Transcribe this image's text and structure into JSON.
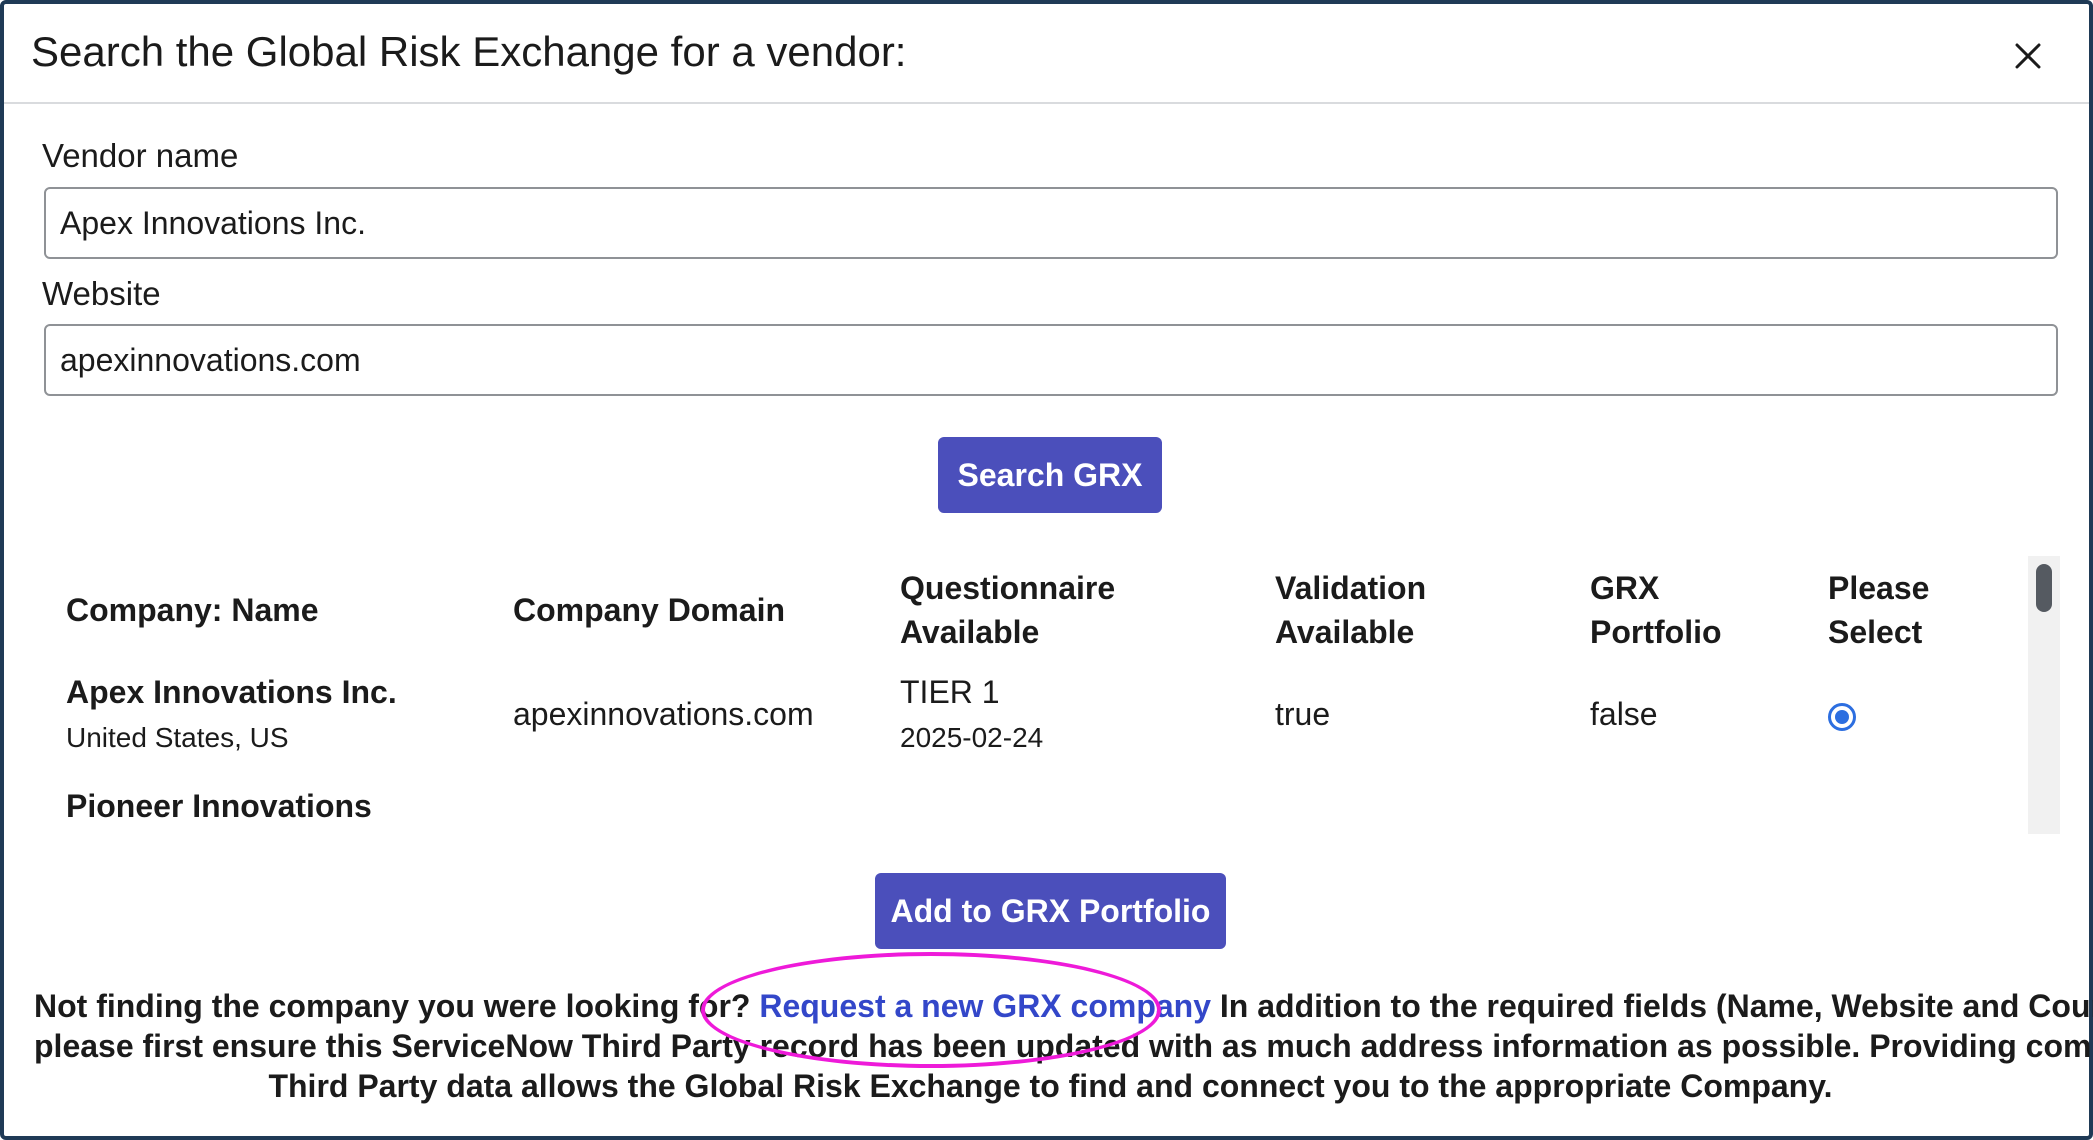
{
  "modal": {
    "title": "Search the Global Risk Exchange for a vendor:",
    "close_icon": "close-icon"
  },
  "form": {
    "vendor_name": {
      "label": "Vendor name",
      "value": "Apex Innovations Inc."
    },
    "website": {
      "label": "Website",
      "value": "apexinnovations.com"
    },
    "search_button": "Search GRX"
  },
  "results": {
    "columns": {
      "name": "Company: Name",
      "domain": "Company Domain",
      "questionnaire_1": "Questionnaire",
      "questionnaire_2": "Available",
      "validation_1": "Validation",
      "validation_2": "Available",
      "portfolio_1": "GRX",
      "portfolio_2": "Portfolio",
      "select_1": "Please",
      "select_2": "Select"
    },
    "rows": [
      {
        "name": "Apex Innovations Inc.",
        "location": "United States, US",
        "domain": "apexinnovations.com",
        "questionnaire_tier": "TIER 1",
        "questionnaire_date": "2025-02-24",
        "validation": "true",
        "portfolio": "false",
        "selected": true
      },
      {
        "name": "Pioneer Innovations"
      }
    ]
  },
  "add_button": "Add to GRX Portfolio",
  "footer": {
    "text_before": "Not finding the company you were looking for? ",
    "link": "Request a new GRX company",
    "text_after": " In addition to the required fields (Name, Website and Country),",
    "line2": "please first ensure this ServiceNow Third Party record has been updated with as much address information as possible. Providing complete",
    "line3": "Third Party data allows the Global Risk Exchange to find and connect you to the appropriate Company."
  },
  "colors": {
    "primary_button": "#4b4fbb",
    "link": "#3347c9",
    "highlight": "#ee1ad9",
    "radio": "#2c6ee0",
    "modal_border": "#1f3a56"
  }
}
